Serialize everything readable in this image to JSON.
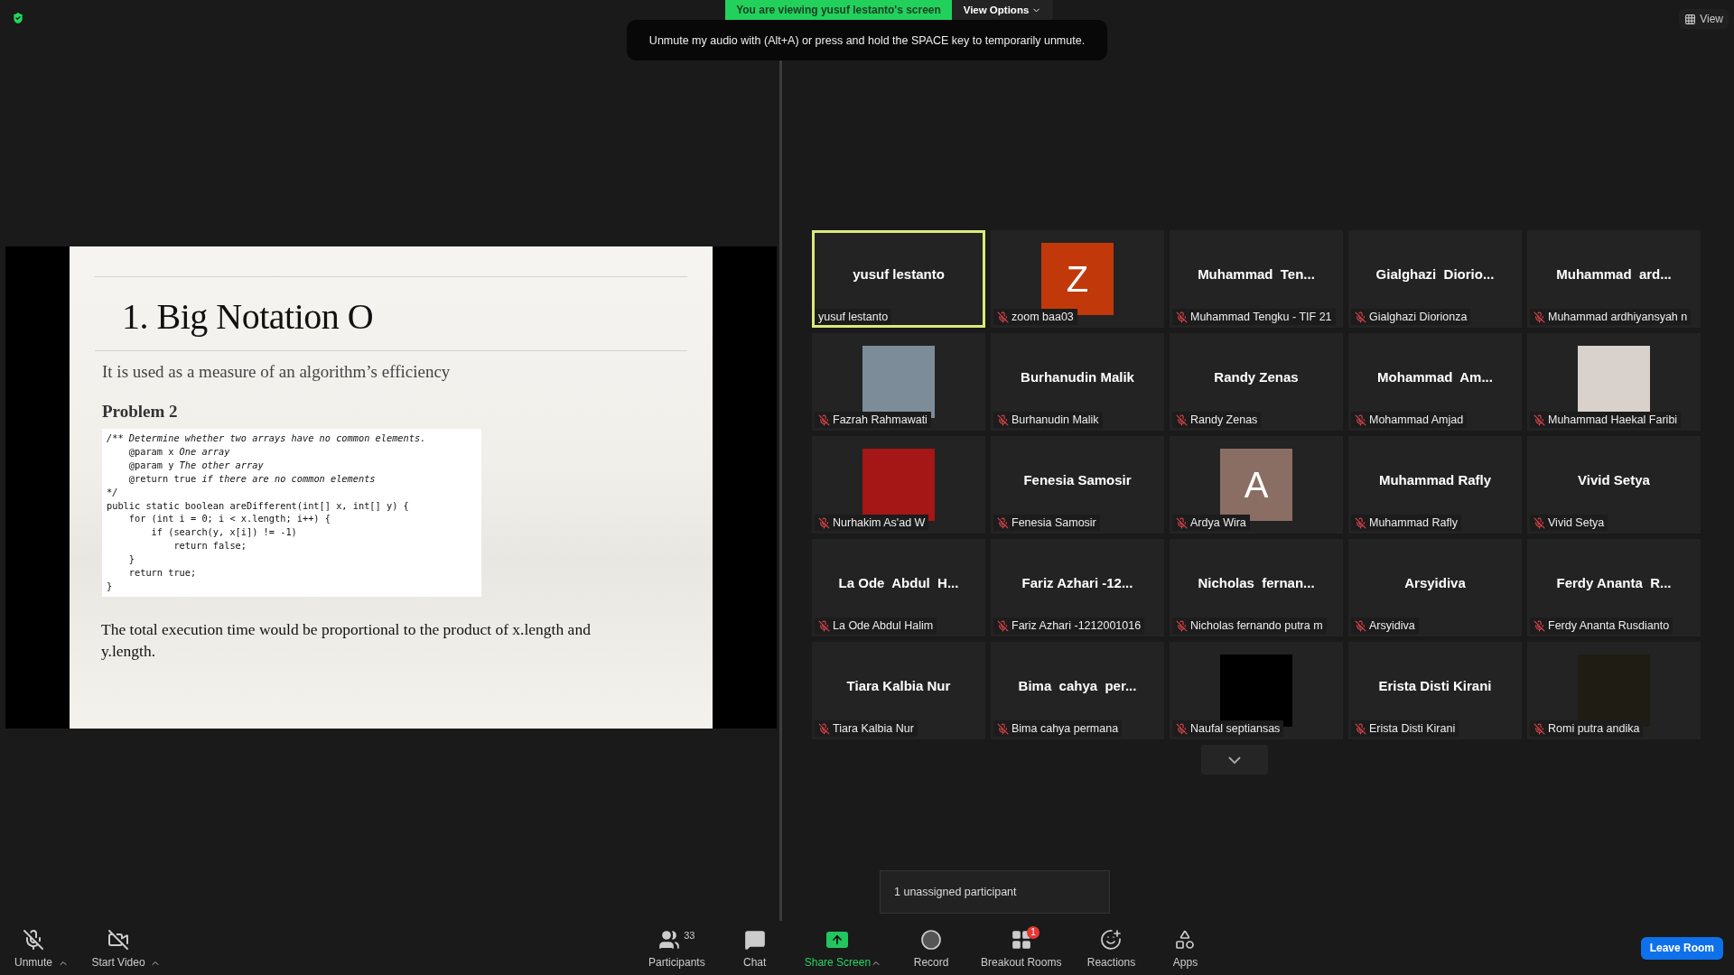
{
  "banner": {
    "viewing": "You are viewing yusuf lestanto's screen",
    "view_options": "View Options"
  },
  "tooltip": "Unmute my audio with (Alt+A) or press and hold the SPACE key to temporarily unmute.",
  "view_button": "View",
  "slide": {
    "title": "1. Big Notation O",
    "subtitle": "It is used as a measure of an algorithm’s efficiency",
    "heading": "Problem 2",
    "code": [
      [
        {
          "text": "/** Determine whether two arrays have no common elements.",
          "italic": true
        }
      ],
      [
        {
          "text": "    @param x ",
          "italic": false
        },
        {
          "text": "One array",
          "italic": true
        }
      ],
      [
        {
          "text": "    @param y ",
          "italic": false
        },
        {
          "text": "The other array",
          "italic": true
        }
      ],
      [
        {
          "text": "    @return true ",
          "italic": false
        },
        {
          "text": "if there are no common elements",
          "italic": true
        }
      ],
      [
        {
          "text": "*/",
          "italic": true
        }
      ],
      [
        {
          "text": "public static boolean areDifferent(int[] x, int[] y) {",
          "italic": false
        }
      ],
      [
        {
          "text": "    for (int i = 0; i < x.length; i++) {",
          "italic": false
        }
      ],
      [
        {
          "text": "        if (search(y, x[i]) != -1)",
          "italic": false
        }
      ],
      [
        {
          "text": "            return false;",
          "italic": false
        }
      ],
      [
        {
          "text": "    }",
          "italic": false
        }
      ],
      [
        {
          "text": "    return true;",
          "italic": false
        }
      ],
      [
        {
          "text": "}",
          "italic": false
        }
      ]
    ],
    "paragraph": "The total execution time would be proportional to the product of x.length and y.length."
  },
  "participants": [
    {
      "kind": "name",
      "display": "yusuf lestanto",
      "label": "yusuf lestanto",
      "muted": false,
      "speaking": true
    },
    {
      "kind": "initial",
      "display": "Z",
      "label": "zoom baa03",
      "muted": true,
      "speaking": false,
      "color": "#c1390b"
    },
    {
      "kind": "name",
      "display": "Muhammad  Ten...",
      "label": "Muhammad Tengku - TIF 21",
      "muted": true,
      "speaking": false
    },
    {
      "kind": "name",
      "display": "Gialghazi  Diorio...",
      "label": "Gialghazi Diorionza",
      "muted": true,
      "speaking": false
    },
    {
      "kind": "name",
      "display": "Muhammad  ard...",
      "label": "Muhammad ardhiyansyah n",
      "muted": true,
      "speaking": false
    },
    {
      "kind": "photo",
      "label": "Fazrah Rahmawati",
      "muted": true,
      "speaking": false,
      "color": "#7d8c99"
    },
    {
      "kind": "name",
      "display": "Burhanudin Malik",
      "label": "Burhanudin Malik",
      "muted": true,
      "speaking": false
    },
    {
      "kind": "name",
      "display": "Randy Zenas",
      "label": "Randy Zenas",
      "muted": true,
      "speaking": false
    },
    {
      "kind": "name",
      "display": "Mohammad  Am...",
      "label": "Mohammad Amjad",
      "muted": true,
      "speaking": false
    },
    {
      "kind": "photo",
      "label": "Muhammad Haekal Faribi",
      "muted": true,
      "speaking": false,
      "color": "#d9d1cc"
    },
    {
      "kind": "photo",
      "label": "Nurhakim As'ad W",
      "muted": true,
      "speaking": false,
      "color": "#a51616"
    },
    {
      "kind": "name",
      "display": "Fenesia Samosir",
      "label": "Fenesia Samosir",
      "muted": true,
      "speaking": false
    },
    {
      "kind": "initial",
      "display": "A",
      "label": "Ardya Wira",
      "muted": true,
      "speaking": false,
      "color": "#8a6e64"
    },
    {
      "kind": "name",
      "display": "Muhammad Rafly",
      "label": "Muhammad Rafly",
      "muted": true,
      "speaking": false
    },
    {
      "kind": "name",
      "display": "Vivid Setya",
      "label": "Vivid Setya",
      "muted": true,
      "speaking": false
    },
    {
      "kind": "name",
      "display": "La Ode  Abdul  H...",
      "label": "La Ode Abdul Halim",
      "muted": true,
      "speaking": false
    },
    {
      "kind": "name",
      "display": "Fariz Azhari -12...",
      "label": "Fariz Azhari -1212001016",
      "muted": true,
      "speaking": false
    },
    {
      "kind": "name",
      "display": "Nicholas  fernan...",
      "label": "Nicholas fernando putra m",
      "muted": true,
      "speaking": false
    },
    {
      "kind": "name",
      "display": "Arsyidiva",
      "label": "Arsyidiva",
      "muted": true,
      "speaking": false
    },
    {
      "kind": "name",
      "display": "Ferdy Ananta  R...",
      "label": "Ferdy Ananta Rusdianto",
      "muted": true,
      "speaking": false
    },
    {
      "kind": "name",
      "display": "Tiara Kalbia Nur",
      "label": "Tiara Kalbia Nur",
      "muted": true,
      "speaking": false
    },
    {
      "kind": "name",
      "display": "Bima  cahya  per...",
      "label": "Bima cahya permana",
      "muted": true,
      "speaking": false
    },
    {
      "kind": "photo",
      "label": "Naufal septiansas",
      "muted": true,
      "speaking": false,
      "color": "#000000"
    },
    {
      "kind": "name",
      "display": "Erista Disti Kirani",
      "label": "Erista Disti Kirani",
      "muted": true,
      "speaking": false
    },
    {
      "kind": "photo",
      "label": "Romi putra andika",
      "muted": true,
      "speaking": false,
      "color": "#1f1c14"
    }
  ],
  "popup": "1 unassigned participant",
  "toolbar": {
    "left": [
      {
        "kind": "mic",
        "label": "Unmute"
      },
      {
        "kind": "video",
        "label": "Start Video"
      }
    ],
    "center": [
      {
        "kind": "participants",
        "label": "Participants",
        "count": "33"
      },
      {
        "kind": "chat",
        "label": "Chat"
      },
      {
        "kind": "share",
        "label": "Share Screen"
      },
      {
        "kind": "record",
        "label": "Record"
      },
      {
        "kind": "breakout",
        "label": "Breakout Rooms",
        "badge": "1"
      },
      {
        "kind": "reactions",
        "label": "Reactions"
      },
      {
        "kind": "apps",
        "label": "Apps"
      }
    ],
    "leave": "Leave Room"
  }
}
